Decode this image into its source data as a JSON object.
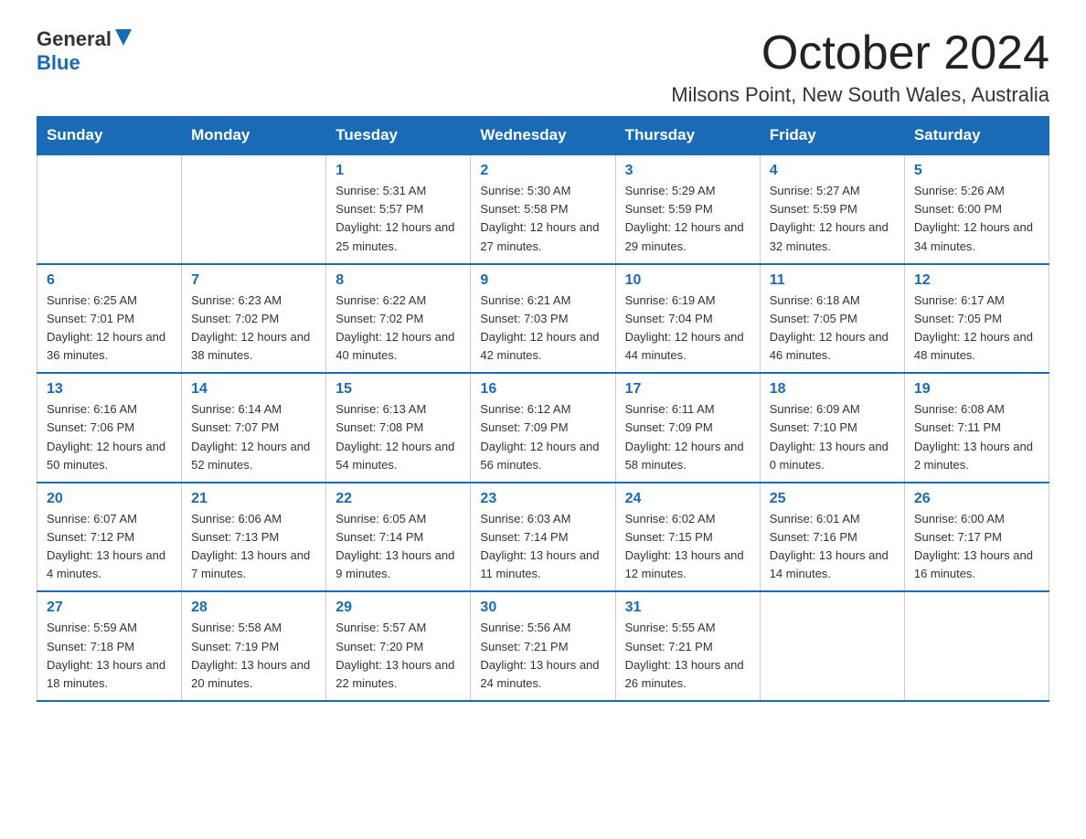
{
  "header": {
    "logo_general": "General",
    "logo_blue": "Blue",
    "month_title": "October 2024",
    "location": "Milsons Point, New South Wales, Australia"
  },
  "weekdays": [
    "Sunday",
    "Monday",
    "Tuesday",
    "Wednesday",
    "Thursday",
    "Friday",
    "Saturday"
  ],
  "weeks": [
    [
      {
        "day": "",
        "sunrise": "",
        "sunset": "",
        "daylight": ""
      },
      {
        "day": "",
        "sunrise": "",
        "sunset": "",
        "daylight": ""
      },
      {
        "day": "1",
        "sunrise": "Sunrise: 5:31 AM",
        "sunset": "Sunset: 5:57 PM",
        "daylight": "Daylight: 12 hours and 25 minutes."
      },
      {
        "day": "2",
        "sunrise": "Sunrise: 5:30 AM",
        "sunset": "Sunset: 5:58 PM",
        "daylight": "Daylight: 12 hours and 27 minutes."
      },
      {
        "day": "3",
        "sunrise": "Sunrise: 5:29 AM",
        "sunset": "Sunset: 5:59 PM",
        "daylight": "Daylight: 12 hours and 29 minutes."
      },
      {
        "day": "4",
        "sunrise": "Sunrise: 5:27 AM",
        "sunset": "Sunset: 5:59 PM",
        "daylight": "Daylight: 12 hours and 32 minutes."
      },
      {
        "day": "5",
        "sunrise": "Sunrise: 5:26 AM",
        "sunset": "Sunset: 6:00 PM",
        "daylight": "Daylight: 12 hours and 34 minutes."
      }
    ],
    [
      {
        "day": "6",
        "sunrise": "Sunrise: 6:25 AM",
        "sunset": "Sunset: 7:01 PM",
        "daylight": "Daylight: 12 hours and 36 minutes."
      },
      {
        "day": "7",
        "sunrise": "Sunrise: 6:23 AM",
        "sunset": "Sunset: 7:02 PM",
        "daylight": "Daylight: 12 hours and 38 minutes."
      },
      {
        "day": "8",
        "sunrise": "Sunrise: 6:22 AM",
        "sunset": "Sunset: 7:02 PM",
        "daylight": "Daylight: 12 hours and 40 minutes."
      },
      {
        "day": "9",
        "sunrise": "Sunrise: 6:21 AM",
        "sunset": "Sunset: 7:03 PM",
        "daylight": "Daylight: 12 hours and 42 minutes."
      },
      {
        "day": "10",
        "sunrise": "Sunrise: 6:19 AM",
        "sunset": "Sunset: 7:04 PM",
        "daylight": "Daylight: 12 hours and 44 minutes."
      },
      {
        "day": "11",
        "sunrise": "Sunrise: 6:18 AM",
        "sunset": "Sunset: 7:05 PM",
        "daylight": "Daylight: 12 hours and 46 minutes."
      },
      {
        "day": "12",
        "sunrise": "Sunrise: 6:17 AM",
        "sunset": "Sunset: 7:05 PM",
        "daylight": "Daylight: 12 hours and 48 minutes."
      }
    ],
    [
      {
        "day": "13",
        "sunrise": "Sunrise: 6:16 AM",
        "sunset": "Sunset: 7:06 PM",
        "daylight": "Daylight: 12 hours and 50 minutes."
      },
      {
        "day": "14",
        "sunrise": "Sunrise: 6:14 AM",
        "sunset": "Sunset: 7:07 PM",
        "daylight": "Daylight: 12 hours and 52 minutes."
      },
      {
        "day": "15",
        "sunrise": "Sunrise: 6:13 AM",
        "sunset": "Sunset: 7:08 PM",
        "daylight": "Daylight: 12 hours and 54 minutes."
      },
      {
        "day": "16",
        "sunrise": "Sunrise: 6:12 AM",
        "sunset": "Sunset: 7:09 PM",
        "daylight": "Daylight: 12 hours and 56 minutes."
      },
      {
        "day": "17",
        "sunrise": "Sunrise: 6:11 AM",
        "sunset": "Sunset: 7:09 PM",
        "daylight": "Daylight: 12 hours and 58 minutes."
      },
      {
        "day": "18",
        "sunrise": "Sunrise: 6:09 AM",
        "sunset": "Sunset: 7:10 PM",
        "daylight": "Daylight: 13 hours and 0 minutes."
      },
      {
        "day": "19",
        "sunrise": "Sunrise: 6:08 AM",
        "sunset": "Sunset: 7:11 PM",
        "daylight": "Daylight: 13 hours and 2 minutes."
      }
    ],
    [
      {
        "day": "20",
        "sunrise": "Sunrise: 6:07 AM",
        "sunset": "Sunset: 7:12 PM",
        "daylight": "Daylight: 13 hours and 4 minutes."
      },
      {
        "day": "21",
        "sunrise": "Sunrise: 6:06 AM",
        "sunset": "Sunset: 7:13 PM",
        "daylight": "Daylight: 13 hours and 7 minutes."
      },
      {
        "day": "22",
        "sunrise": "Sunrise: 6:05 AM",
        "sunset": "Sunset: 7:14 PM",
        "daylight": "Daylight: 13 hours and 9 minutes."
      },
      {
        "day": "23",
        "sunrise": "Sunrise: 6:03 AM",
        "sunset": "Sunset: 7:14 PM",
        "daylight": "Daylight: 13 hours and 11 minutes."
      },
      {
        "day": "24",
        "sunrise": "Sunrise: 6:02 AM",
        "sunset": "Sunset: 7:15 PM",
        "daylight": "Daylight: 13 hours and 12 minutes."
      },
      {
        "day": "25",
        "sunrise": "Sunrise: 6:01 AM",
        "sunset": "Sunset: 7:16 PM",
        "daylight": "Daylight: 13 hours and 14 minutes."
      },
      {
        "day": "26",
        "sunrise": "Sunrise: 6:00 AM",
        "sunset": "Sunset: 7:17 PM",
        "daylight": "Daylight: 13 hours and 16 minutes."
      }
    ],
    [
      {
        "day": "27",
        "sunrise": "Sunrise: 5:59 AM",
        "sunset": "Sunset: 7:18 PM",
        "daylight": "Daylight: 13 hours and 18 minutes."
      },
      {
        "day": "28",
        "sunrise": "Sunrise: 5:58 AM",
        "sunset": "Sunset: 7:19 PM",
        "daylight": "Daylight: 13 hours and 20 minutes."
      },
      {
        "day": "29",
        "sunrise": "Sunrise: 5:57 AM",
        "sunset": "Sunset: 7:20 PM",
        "daylight": "Daylight: 13 hours and 22 minutes."
      },
      {
        "day": "30",
        "sunrise": "Sunrise: 5:56 AM",
        "sunset": "Sunset: 7:21 PM",
        "daylight": "Daylight: 13 hours and 24 minutes."
      },
      {
        "day": "31",
        "sunrise": "Sunrise: 5:55 AM",
        "sunset": "Sunset: 7:21 PM",
        "daylight": "Daylight: 13 hours and 26 minutes."
      },
      {
        "day": "",
        "sunrise": "",
        "sunset": "",
        "daylight": ""
      },
      {
        "day": "",
        "sunrise": "",
        "sunset": "",
        "daylight": ""
      }
    ]
  ]
}
